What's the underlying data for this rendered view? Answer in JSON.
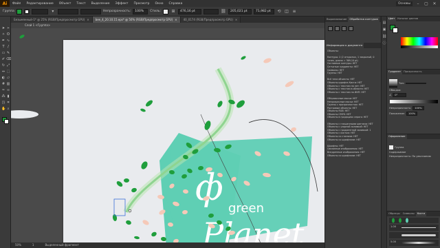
{
  "app": {
    "logo": "Ai",
    "menus": [
      "Файл",
      "Редактирование",
      "Объект",
      "Текст",
      "Выделение",
      "Эффект",
      "Просмотр",
      "Окно",
      "Справка"
    ],
    "workspace": "Основы"
  },
  "control": {
    "selection_label": "Группа",
    "stroke_label": "Обводка:",
    "stroke_value": "",
    "opacity_label": "Непрозрачность:",
    "opacity_value": "100%",
    "style_label": "Стиль:",
    "x_value": "476,16 pt",
    "y_value": "",
    "w_value": "205,021 pt",
    "h_value": "",
    "angle_value": "71,982 pt"
  },
  "tabs": [
    {
      "label": "Безымянный-1* @ 25% (RGB/Предпросмотр GPU)",
      "active": false
    },
    {
      "label": "bee_4_20.10.15.eps* @ 50% (RGB/Предпросмотр GPU)",
      "active": true
    },
    {
      "label": "40_0174 (RGB/Предпросмотр GPU)",
      "active": false
    }
  ],
  "breadcrumb": "Слой 1   <Группа>",
  "statusbar": {
    "zoom": "50%",
    "page": "1",
    "tool": "Выделенный фрагмент"
  },
  "artwork": {
    "word_green": "green",
    "word_planet": "Planet",
    "colors": {
      "leaf_green": "#1f9e3c",
      "leaf_pink": "#f5c9b8",
      "teal": "#5fcfb4",
      "teal_dark": "#4cc0a4",
      "stem": "#8fd490"
    }
  },
  "panelA": {
    "tabs": [
      "Выравнивание",
      "Обработка контуров"
    ],
    "sub_tabs": [
      "Информация о документе"
    ],
    "lines": [
      "Объекты:",
      "",
      "Контуры: 2 (2 открытых, 1 закрытый, 0",
      "точек, длина = 369,10 pt)",
      "Составные контуры: НЕТ",
      "Сетчатые градиенты: НЕТ",
      "Символы: НЕТ",
      "Группы: НЕТ",
      "",
      "Всё тела объекты: НЕТ",
      "Объекты шрифта Кисти: НЕТ",
      "Объекты с текстом на лет: НЕТ",
      "Объекты с текстом в области: НЕТ",
      "Объекты с текстом по ИИП: НЕТ",
      "",
      "Обтравочные маски: НЕТ",
      "Непрозрачные маски: НЕТ",
      "Группы с прозрачностью: НЕТ",
      "Растровые объекты: НЕТ",
      "Объекты RGB: НЕТ",
      "Объекты CMYK: НЕТ",
      "Объекты в градациях серого: НЕТ",
      "",
      "Объекты с плашечными цветами: НЕТ",
      "Объекты с узорной заливкой: НЕТ",
      "Объекты с градиентной заливкой: 1",
      "Объекты с кистью: НЕТ",
      "Объекты со стилями: НЕТ",
      "Объекты со шрифтами: НЕТ",
      "",
      "Шрифты: НЕТ",
      "Связанные изображения: НЕТ",
      "Внедренные изображения: НЕТ",
      "Объекты со шрифтами: НЕТ"
    ]
  },
  "panelB": {
    "top_tabs": [
      "Цвет",
      "Каталог цветов"
    ],
    "gradient_tabs": [
      "Градиент",
      "Прозрачность"
    ],
    "gradient_type_label": "Тип:",
    "gradient_type": "",
    "stroke_label": "Обводка:",
    "angle_value": "0°",
    "opacity_label": "Непрозрачность:",
    "opacity_value": "100%",
    "location_label": "Положение:",
    "location_value": "100%",
    "appearance_tabs": [
      "Оформление"
    ],
    "appearance_group": "Группа",
    "appearance_contents": "Содержимое",
    "appearance_opacity": "Непрозрачность: По умолчанию",
    "brushes_tabs": [
      "Образцы",
      "Символы",
      "Кисти"
    ],
    "brush_sizes": [
      "1.00",
      "",
      "",
      "5.00"
    ],
    "brush_labels": [
      "",
      "",
      "",
      ""
    ]
  }
}
